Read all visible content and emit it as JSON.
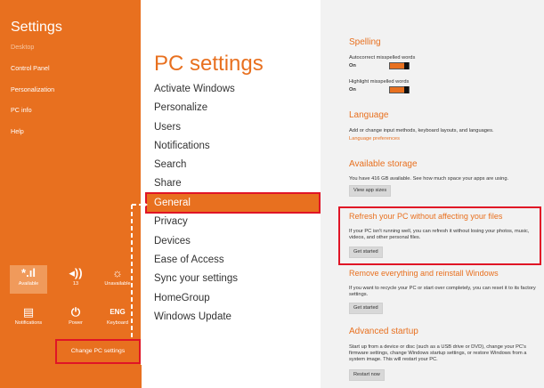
{
  "charms": {
    "title": "Settings",
    "items": [
      "Desktop",
      "Control Panel",
      "Personalization",
      "PC info",
      "Help"
    ],
    "quick": [
      {
        "icon": "wifi-icon",
        "glyph": "*.ıl",
        "label": "Available"
      },
      {
        "icon": "volume-icon",
        "glyph": "◂))",
        "label": "13"
      },
      {
        "icon": "brightness-icon",
        "glyph": "☼",
        "label": "Unavailable"
      },
      {
        "icon": "notifications-icon",
        "glyph": "▤",
        "label": "Notifications"
      },
      {
        "icon": "power-icon",
        "glyph": "⏻",
        "label": "Power"
      },
      {
        "icon": "keyboard-icon",
        "glyph": "ENG",
        "label": "Keyboard"
      }
    ],
    "change_pc_settings": "Change PC settings"
  },
  "pc_settings": {
    "title": "PC settings",
    "nav": [
      "Activate Windows",
      "Personalize",
      "Users",
      "Notifications",
      "Search",
      "Share",
      "General",
      "Privacy",
      "Devices",
      "Ease of Access",
      "Sync your settings",
      "HomeGroup",
      "Windows Update"
    ],
    "selected": "General"
  },
  "general": {
    "spelling": {
      "heading": "Spelling",
      "autocorrect_label": "Autocorrect misspelled words",
      "autocorrect_value": "On",
      "highlight_label": "Highlight misspelled words",
      "highlight_value": "On"
    },
    "language": {
      "heading": "Language",
      "desc": "Add or change input methods, keyboard layouts, and languages.",
      "link": "Language preferences"
    },
    "storage": {
      "heading": "Available storage",
      "desc": "You have 416 GB available. See how much space your apps are using.",
      "button": "View app sizes"
    },
    "refresh": {
      "heading": "Refresh your PC without affecting your files",
      "desc": "If your PC isn't running well, you can refresh it without losing your photos, music, videos, and other personal files.",
      "button": "Get started"
    },
    "reset": {
      "heading": "Remove everything and reinstall Windows",
      "desc": "If you want to recycle your PC or start over completely, you can reset it to its factory settings.",
      "button": "Get started"
    },
    "advanced": {
      "heading": "Advanced startup",
      "desc": "Start up from a device or disc (such as a USB drive or DVD), change your PC's firmware settings, change Windows startup settings, or restore Windows from a system image. This will restart your PC.",
      "button": "Restart now"
    }
  },
  "colors": {
    "accent": "#e8701f",
    "highlight": "#e01526"
  }
}
